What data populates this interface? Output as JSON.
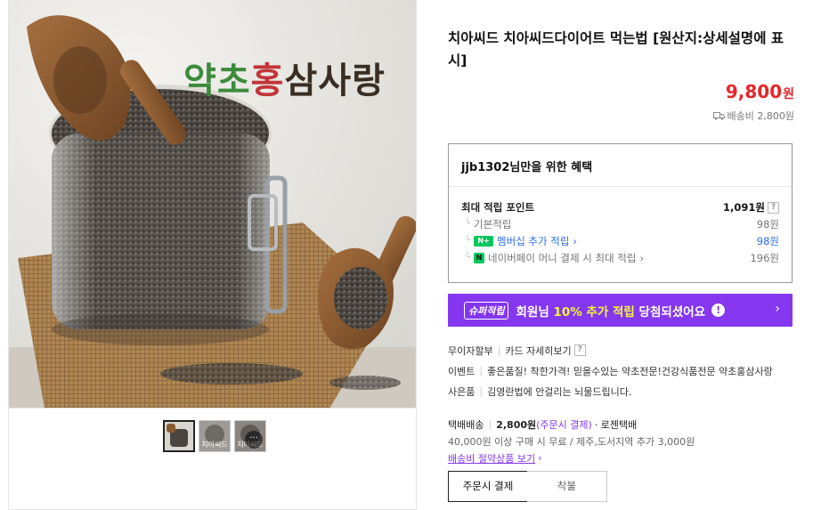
{
  "gallery": {
    "brand_text": "약초홍삼사랑",
    "brand_colors": {
      "primary": "#3a2e24",
      "green": "#3d8b3d",
      "red": "#c2353a"
    },
    "thumbnails": [
      {
        "label": "",
        "active": true
      },
      {
        "label": "치아씨드",
        "active": false
      },
      {
        "label": "치아씨드",
        "active": false,
        "badge": "···"
      }
    ]
  },
  "product": {
    "title": "치아씨드 치아씨드다이어트 먹는법 [원산지:상세설명에 표시]",
    "price": "9,800",
    "price_unit": "원",
    "shipping_summary": "배송비 2,800원"
  },
  "benefits": {
    "heading": "jjb1302님만을 위한 혜택",
    "max_points_label": "최대 적립 포인트",
    "max_points_value": "1,091원",
    "rows": [
      {
        "label": "기본적립",
        "value": "98원"
      },
      {
        "label": "멤버십 추가 적립",
        "value": "98원",
        "badge": "N+"
      },
      {
        "label": "네이버페이 머니 결제 시 최대 적립",
        "value": "196원",
        "badge": "N"
      }
    ]
  },
  "super_banner": {
    "tag": "슈퍼적립",
    "message_pre": "회원님 ",
    "message_highlight": "10% 추가 적립",
    "message_post": " 당첨되셨어요",
    "accent": "#8437ef"
  },
  "info": {
    "installment": "무이자할부",
    "card_detail": "카드 자세히보기",
    "event_label": "이벤트",
    "event_text": "좋은품질! 착한가격! 믿을수있는 약초전문!건강식품전문 약초홍삼사랑",
    "gift_label": "사은품",
    "gift_text": "김영란법에 안걸리는 뇌물드립니다."
  },
  "delivery": {
    "method": "택배배송",
    "fee": "2,800원",
    "fee_note": "(주문시 결제)",
    "carrier": "· 로젠택배",
    "free_condition": "40,000원 이상 구매 시 무료 / 제주,도서지역 추가 3,000원",
    "save_link": "배송비 절약상품 보기"
  },
  "payment_options": {
    "selected": "주문시 결제",
    "other": "착불"
  }
}
